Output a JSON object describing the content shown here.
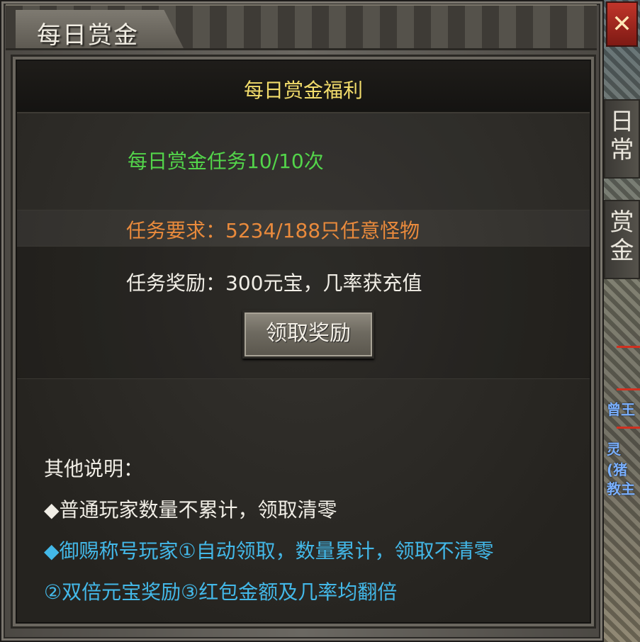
{
  "window": {
    "title": "每日赏金",
    "close_label": "✕"
  },
  "side_tabs": [
    {
      "label": "日常"
    },
    {
      "label": "赏金"
    }
  ],
  "scene_fragments": [
    "曾王",
    "灵(猪",
    "教主"
  ],
  "panel": {
    "header": "每日赏金福利",
    "task_count": "每日赏金任务10/10次",
    "requirement": "任务要求：5234/188只任意怪物",
    "reward": "任务奖励：300元宝，几率获充值",
    "claim_button": "领取奖励"
  },
  "notes": {
    "title": "其他说明：",
    "line1": "◆普通玩家数量不累计，领取清零",
    "line2": "◆御赐称号玩家①自动领取，数量累计，领取不清零",
    "line3": "②双倍元宝奖励③红包金额及几率均翻倍"
  },
  "colors": {
    "header_text": "#f2dc6b",
    "task_count": "#53d44a",
    "requirement": "#e98a3c",
    "vip_note": "#43b8e8",
    "close_button": "#c0352a"
  }
}
